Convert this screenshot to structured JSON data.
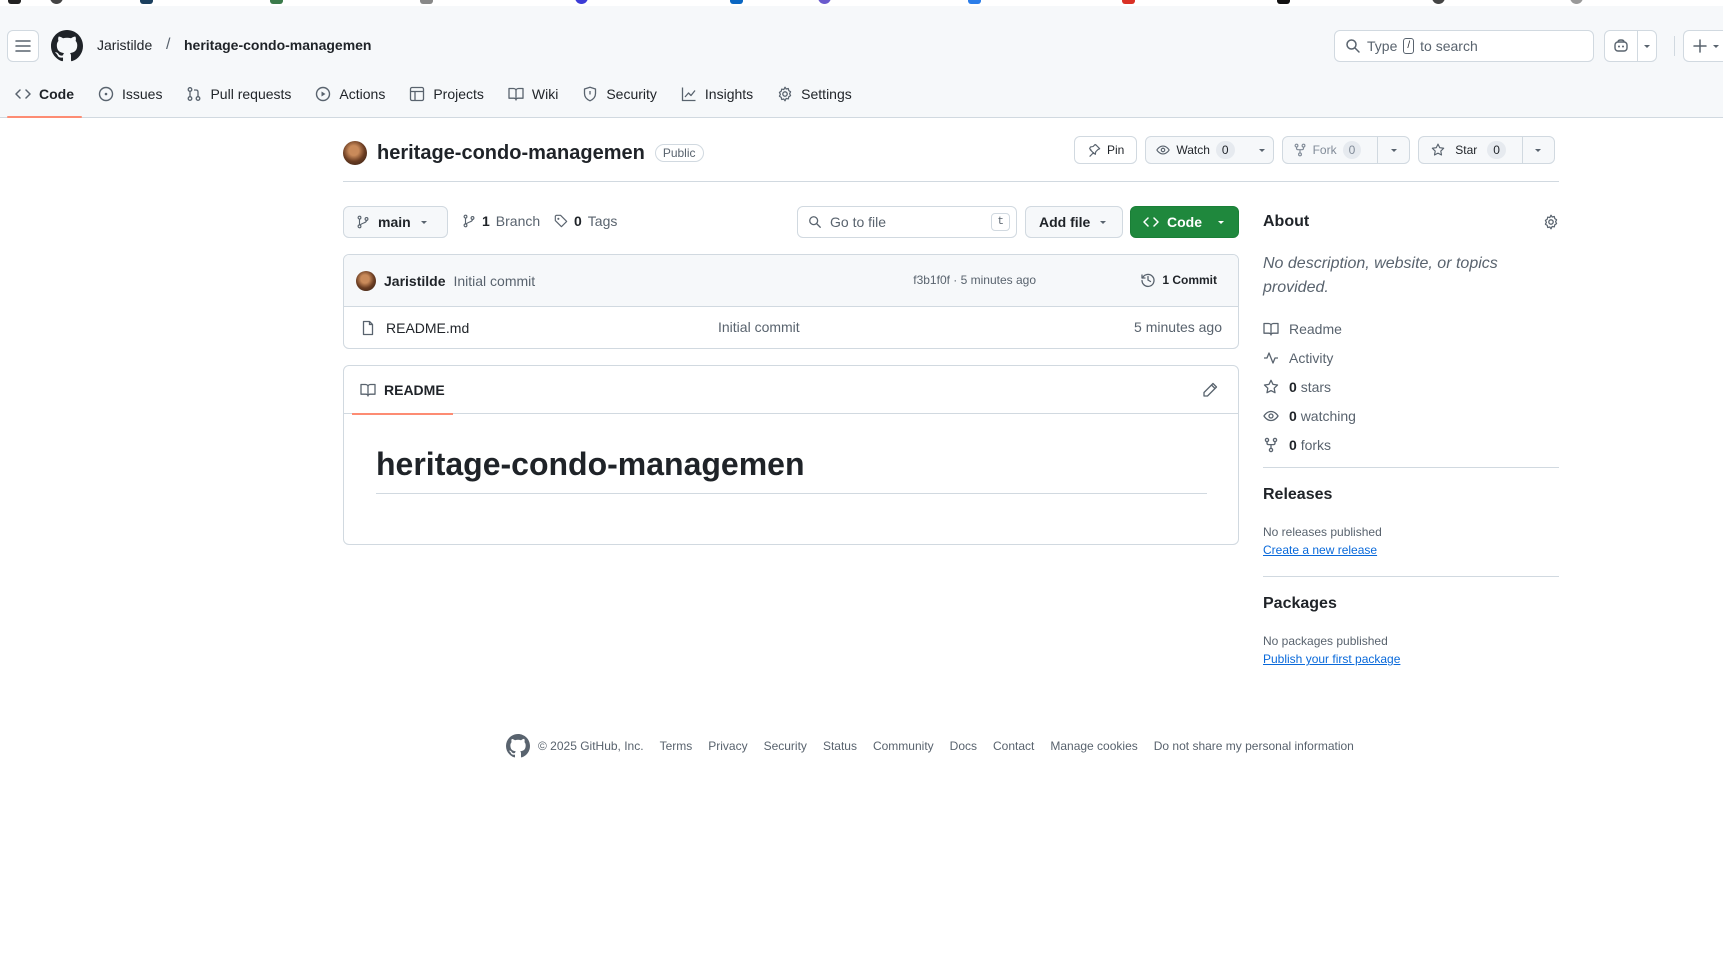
{
  "header": {
    "owner": "Jaristilde",
    "separator": "/",
    "repo": "heritage-condo-managemen",
    "search_prefix": "Type",
    "search_key": "/",
    "search_suffix": "to search"
  },
  "tabs": [
    {
      "label": "Code",
      "icon": "code-icon",
      "active": true
    },
    {
      "label": "Issues",
      "icon": "issue-icon"
    },
    {
      "label": "Pull requests",
      "icon": "pull-request-icon"
    },
    {
      "label": "Actions",
      "icon": "play-icon"
    },
    {
      "label": "Projects",
      "icon": "table-icon"
    },
    {
      "label": "Wiki",
      "icon": "book-icon"
    },
    {
      "label": "Security",
      "icon": "shield-icon"
    },
    {
      "label": "Insights",
      "icon": "graph-icon"
    },
    {
      "label": "Settings",
      "icon": "gear-icon"
    }
  ],
  "repo": {
    "name": "heritage-condo-managemen",
    "visibility": "Public",
    "pin_label": "Pin",
    "watch_label": "Watch",
    "watch_count": "0",
    "fork_label": "Fork",
    "fork_count": "0",
    "star_label": "Star",
    "star_count": "0"
  },
  "nav": {
    "branch": "main",
    "branch_count": "1",
    "branch_label": "Branch",
    "tag_count": "0",
    "tag_label": "Tags",
    "go_to_file": "Go to file",
    "go_to_file_key": "t",
    "add_file": "Add file",
    "code": "Code"
  },
  "commit": {
    "author": "Jaristilde",
    "message": "Initial commit",
    "meta": "f3b1f0f · 5 minutes ago",
    "count_label": "1 Commit"
  },
  "files": [
    {
      "name": "README.md",
      "message": "Initial commit",
      "age": "5 minutes ago"
    }
  ],
  "readme": {
    "tab_label": "README",
    "title": "heritage-condo-managemen"
  },
  "about": {
    "title": "About",
    "description": "No description, website, or topics provided.",
    "readme": "Readme",
    "activity": "Activity",
    "stars_count": "0",
    "stars_label": "stars",
    "watching_count": "0",
    "watching_label": "watching",
    "forks_count": "0",
    "forks_label": "forks"
  },
  "releases": {
    "title": "Releases",
    "note": "No releases published",
    "link": "Create a new release"
  },
  "packages": {
    "title": "Packages",
    "note": "No packages published",
    "link": "Publish your first package"
  },
  "footer": {
    "copyright": "© 2025 GitHub, Inc.",
    "links": [
      "Terms",
      "Privacy",
      "Security",
      "Status",
      "Community",
      "Docs",
      "Contact",
      "Manage cookies",
      "Do not share my personal information"
    ]
  },
  "colors": {
    "accent_green": "#1f883d",
    "tab_underline": "#fd8c73",
    "link_blue": "#0969da"
  }
}
